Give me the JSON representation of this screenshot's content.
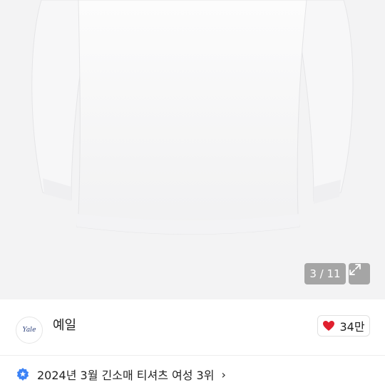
{
  "gallery": {
    "current": 3,
    "total": 11,
    "counter_text": "3 / 11",
    "product_color": "#ffffff",
    "background_color": "#f3f3f4",
    "image_description_icon": "tshirt-image"
  },
  "seller": {
    "logo_text": "Yale",
    "name": "예일",
    "likes": "34만",
    "heart_color": "#e0202e"
  },
  "ranking": {
    "text": "2024년 3월 긴소매 티셔츠 여성 3위",
    "badge_color": "#3b82f6",
    "chevron": "›"
  }
}
